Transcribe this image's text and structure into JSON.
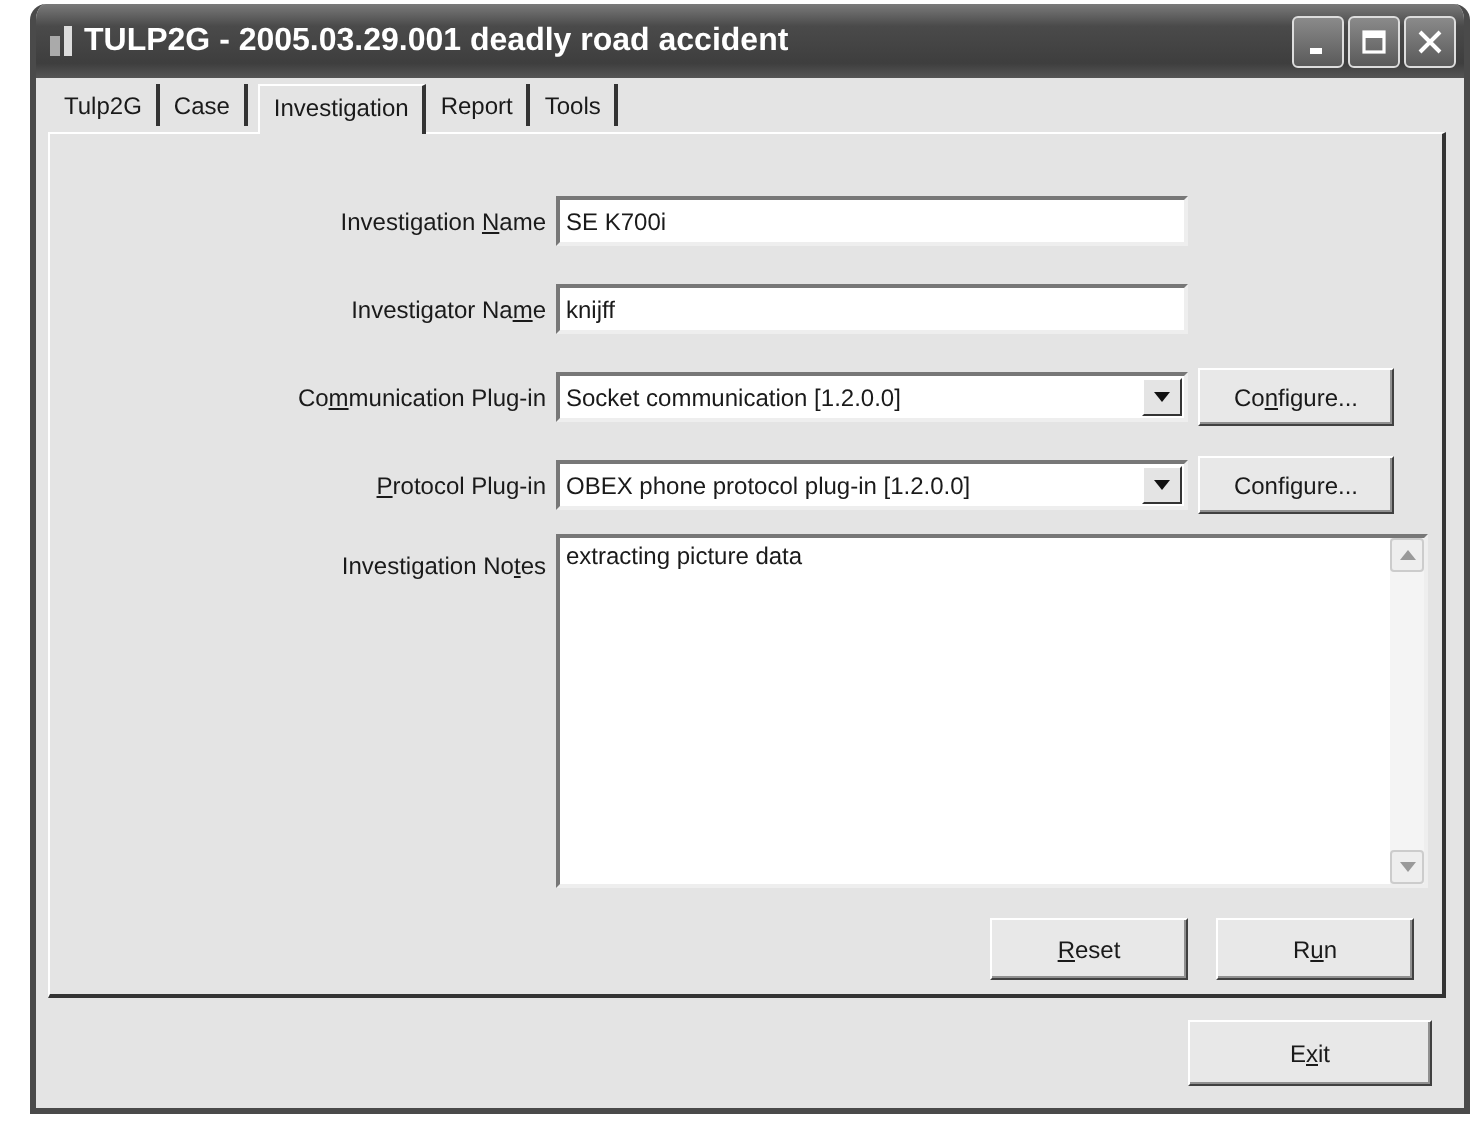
{
  "window": {
    "title": "TULP2G - 2005.03.29.001 deadly road accident"
  },
  "tabs": [
    {
      "label": "Tulp2G",
      "selected": false
    },
    {
      "label": "Case",
      "selected": false
    },
    {
      "label": "Investigation",
      "selected": true
    },
    {
      "label": "Report",
      "selected": false
    },
    {
      "label": "Tools",
      "selected": false
    }
  ],
  "fields": [
    {
      "kind": "text",
      "label": {
        "before": "Investigation ",
        "key": "N",
        "after": "ame"
      },
      "value": "SE K700i"
    },
    {
      "kind": "text",
      "label": {
        "before": "Investigator Na",
        "key": "m",
        "after": "e"
      },
      "value": "knijff"
    },
    {
      "kind": "combo",
      "label": {
        "before": "Co",
        "key": "m",
        "after": "munication Plug-in"
      },
      "value": "Socket communication [1.2.0.0]",
      "button": {
        "before": "Co",
        "key": "n",
        "after": "figure..."
      }
    },
    {
      "kind": "combo",
      "label": {
        "key": "P",
        "after": "rotocol Plug-in"
      },
      "value": "OBEX phone protocol plug-in [1.2.0.0]",
      "button": {
        "before": "Confi",
        "key": "g",
        "after": "ure..."
      }
    }
  ],
  "notes": {
    "label": {
      "before": "Investigation No",
      "key": "t",
      "after": "es"
    },
    "value": "extracting picture data"
  },
  "actions": [
    {
      "key": "R",
      "after": "eset"
    },
    {
      "before": "R",
      "key": "u",
      "after": "n"
    }
  ],
  "exit_button": {
    "before": "E",
    "key": "x",
    "after": "it"
  }
}
